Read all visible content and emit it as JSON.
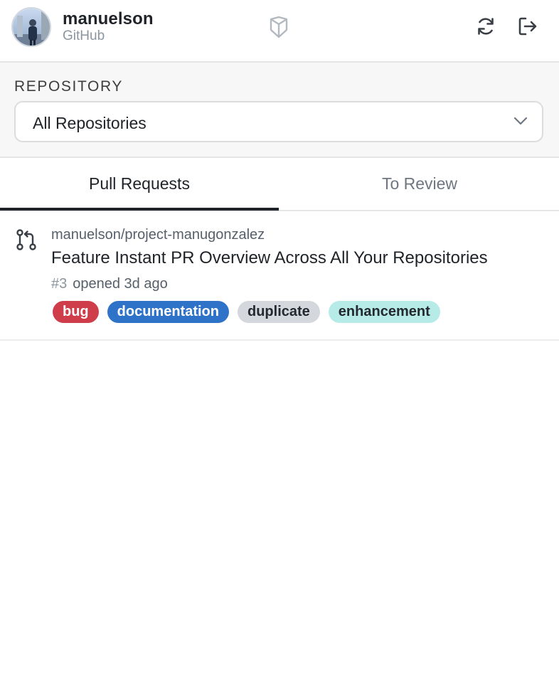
{
  "header": {
    "user_name": "manuelson",
    "provider": "GitHub",
    "icons": {
      "avatar": "user-avatar",
      "logo": "app-logo-icon",
      "refresh": "refresh-icon",
      "logout": "logout-icon"
    }
  },
  "filter": {
    "label": "REPOSITORY",
    "selected": "All Repositories"
  },
  "tabs": [
    {
      "label": "Pull Requests",
      "active": true
    },
    {
      "label": "To Review",
      "active": false
    }
  ],
  "pull_requests": [
    {
      "repo": "manuelson/project-manugonzalez",
      "title": "Feature Instant PR Overview Across All Your Repositories",
      "number": "#3",
      "opened": "opened 3d ago",
      "labels": [
        {
          "name": "bug",
          "bg": "#cf3d4a",
          "fg": "#ffffff"
        },
        {
          "name": "documentation",
          "bg": "#2f73c8",
          "fg": "#ffffff"
        },
        {
          "name": "duplicate",
          "bg": "#d4d7dc",
          "fg": "#24292f"
        },
        {
          "name": "enhancement",
          "bg": "#b6ebe8",
          "fg": "#24292f"
        }
      ]
    }
  ],
  "colors": {
    "accent": "#1f2328",
    "muted": "#8c959f",
    "section_bg": "#f7f7f7"
  }
}
